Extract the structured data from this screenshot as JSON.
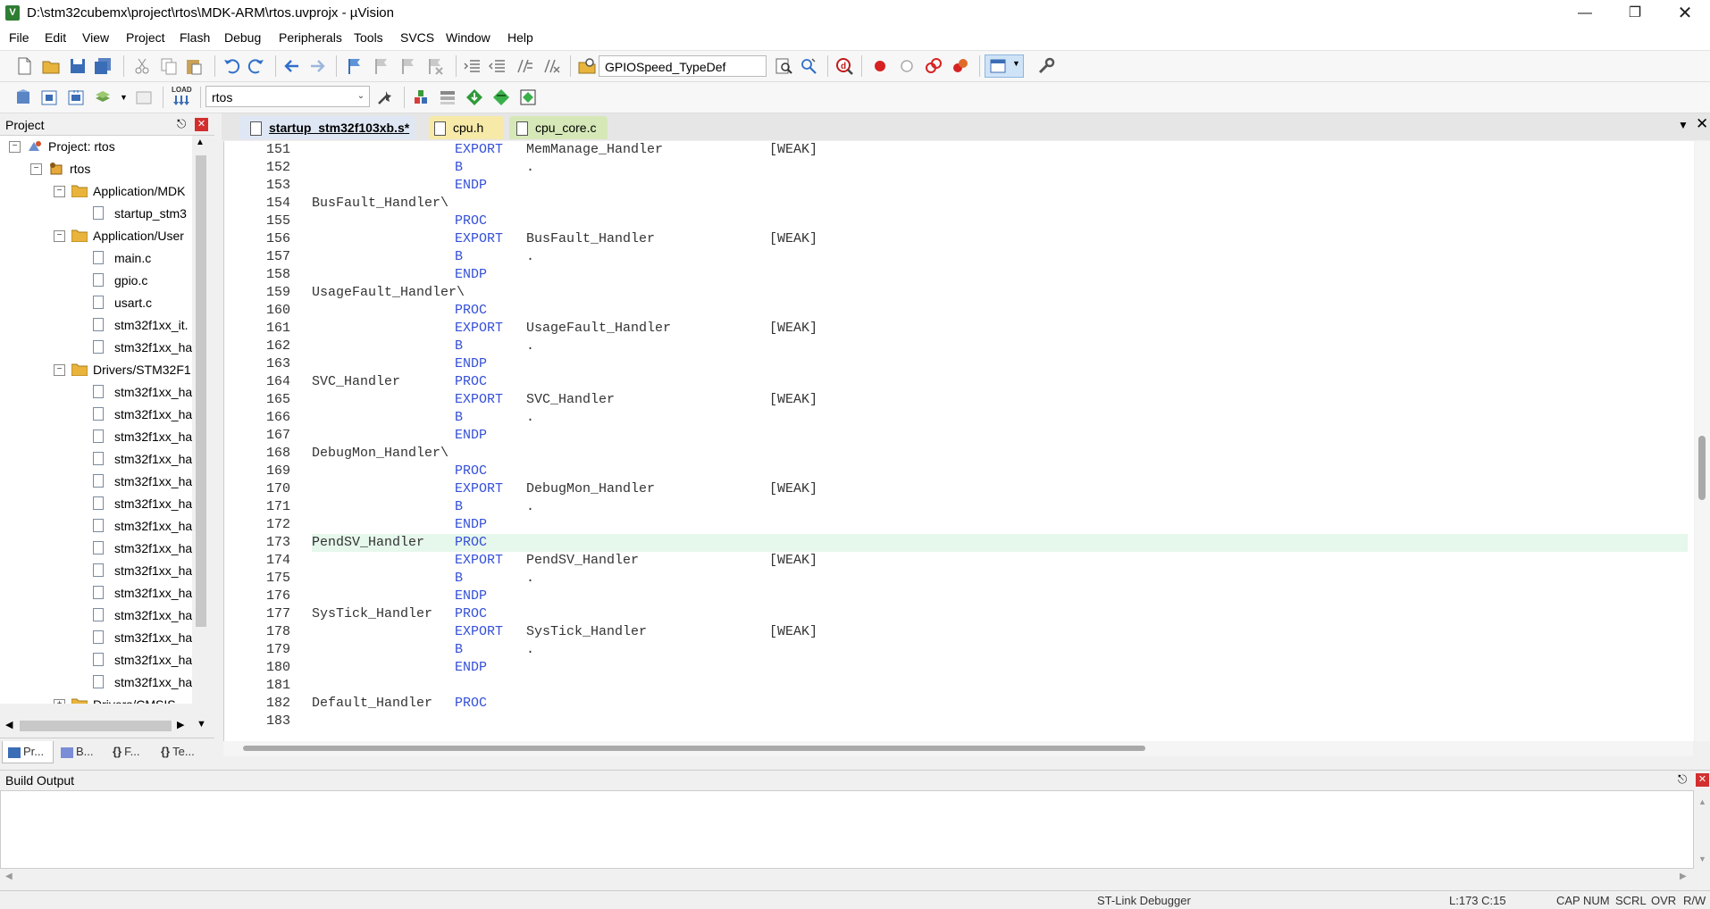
{
  "window": {
    "title": "D:\\stm32cubemx\\project\\rtos\\MDK-ARM\\rtos.uvprojx - µVision",
    "app_icon": "V"
  },
  "menu": [
    "File",
    "Edit",
    "View",
    "Project",
    "Flash",
    "Debug",
    "Peripherals",
    "Tools",
    "SVCS",
    "Window",
    "Help"
  ],
  "toolbar": {
    "find_combo_value": "GPIOSpeed_TypeDef",
    "target_combo_value": "rtos",
    "load_label": "LOAD"
  },
  "project_panel": {
    "title": "Project",
    "tree": [
      {
        "label": "Project: rtos",
        "level": 0,
        "kind": "project",
        "expanded": true
      },
      {
        "label": "rtos",
        "level": 1,
        "kind": "target",
        "expanded": true
      },
      {
        "label": "Application/MDK",
        "level": 2,
        "kind": "folder",
        "expanded": true
      },
      {
        "label": "startup_stm3",
        "level": 3,
        "kind": "file"
      },
      {
        "label": "Application/User",
        "level": 2,
        "kind": "folder",
        "expanded": true
      },
      {
        "label": "main.c",
        "level": 3,
        "kind": "file"
      },
      {
        "label": "gpio.c",
        "level": 3,
        "kind": "file"
      },
      {
        "label": "usart.c",
        "level": 3,
        "kind": "file"
      },
      {
        "label": "stm32f1xx_it.",
        "level": 3,
        "kind": "file"
      },
      {
        "label": "stm32f1xx_ha",
        "level": 3,
        "kind": "file"
      },
      {
        "label": "Drivers/STM32F1",
        "level": 2,
        "kind": "folder",
        "expanded": true
      },
      {
        "label": "stm32f1xx_ha",
        "level": 3,
        "kind": "file"
      },
      {
        "label": "stm32f1xx_ha",
        "level": 3,
        "kind": "file"
      },
      {
        "label": "stm32f1xx_ha",
        "level": 3,
        "kind": "file"
      },
      {
        "label": "stm32f1xx_ha",
        "level": 3,
        "kind": "file"
      },
      {
        "label": "stm32f1xx_ha",
        "level": 3,
        "kind": "file"
      },
      {
        "label": "stm32f1xx_ha",
        "level": 3,
        "kind": "file"
      },
      {
        "label": "stm32f1xx_ha",
        "level": 3,
        "kind": "file"
      },
      {
        "label": "stm32f1xx_ha",
        "level": 3,
        "kind": "file"
      },
      {
        "label": "stm32f1xx_ha",
        "level": 3,
        "kind": "file"
      },
      {
        "label": "stm32f1xx_ha",
        "level": 3,
        "kind": "file"
      },
      {
        "label": "stm32f1xx_ha",
        "level": 3,
        "kind": "file"
      },
      {
        "label": "stm32f1xx_ha",
        "level": 3,
        "kind": "file"
      },
      {
        "label": "stm32f1xx_ha",
        "level": 3,
        "kind": "file"
      },
      {
        "label": "stm32f1xx_ha",
        "level": 3,
        "kind": "file"
      },
      {
        "label": "Drivers/CMSIS",
        "level": 2,
        "kind": "folder",
        "expanded": false
      }
    ],
    "tabs": [
      "Pr...",
      "B...",
      "F...",
      "Te..."
    ],
    "tab_glyphs": [
      "",
      "",
      "{}",
      "{}"
    ]
  },
  "editor": {
    "tabs": [
      {
        "label": "startup_stm32f103xb.s*",
        "active": true,
        "color": "#dfe7f5"
      },
      {
        "label": "cpu.h",
        "active": false,
        "color": "#f7e9a8"
      },
      {
        "label": "cpu_core.c",
        "active": false,
        "color": "#d6e8b8"
      }
    ],
    "highlighted_line": 173,
    "lines": [
      {
        "n": "151",
        "label": "",
        "kw": "EXPORT",
        "arg": "MemManage_Handler",
        "weak": "[WEAK]"
      },
      {
        "n": "152",
        "label": "",
        "kw": "B",
        "arg": ".",
        "weak": ""
      },
      {
        "n": "153",
        "label": "",
        "kw": "ENDP",
        "arg": "",
        "weak": ""
      },
      {
        "n": "154",
        "label": "BusFault_Handler\\",
        "kw": "",
        "arg": "",
        "weak": ""
      },
      {
        "n": "155",
        "label": "",
        "kw": "PROC",
        "arg": "",
        "weak": ""
      },
      {
        "n": "156",
        "label": "",
        "kw": "EXPORT",
        "arg": "BusFault_Handler",
        "weak": "[WEAK]"
      },
      {
        "n": "157",
        "label": "",
        "kw": "B",
        "arg": ".",
        "weak": ""
      },
      {
        "n": "158",
        "label": "",
        "kw": "ENDP",
        "arg": "",
        "weak": ""
      },
      {
        "n": "159",
        "label": "UsageFault_Handler\\",
        "kw": "",
        "arg": "",
        "weak": ""
      },
      {
        "n": "160",
        "label": "",
        "kw": "PROC",
        "arg": "",
        "weak": ""
      },
      {
        "n": "161",
        "label": "",
        "kw": "EXPORT",
        "arg": "UsageFault_Handler",
        "weak": "[WEAK]"
      },
      {
        "n": "162",
        "label": "",
        "kw": "B",
        "arg": ".",
        "weak": ""
      },
      {
        "n": "163",
        "label": "",
        "kw": "ENDP",
        "arg": "",
        "weak": ""
      },
      {
        "n": "164",
        "label": "SVC_Handler",
        "kw": "PROC",
        "arg": "",
        "weak": ""
      },
      {
        "n": "165",
        "label": "",
        "kw": "EXPORT",
        "arg": "SVC_Handler",
        "weak": "[WEAK]"
      },
      {
        "n": "166",
        "label": "",
        "kw": "B",
        "arg": ".",
        "weak": ""
      },
      {
        "n": "167",
        "label": "",
        "kw": "ENDP",
        "arg": "",
        "weak": ""
      },
      {
        "n": "168",
        "label": "DebugMon_Handler\\",
        "kw": "",
        "arg": "",
        "weak": ""
      },
      {
        "n": "169",
        "label": "",
        "kw": "PROC",
        "arg": "",
        "weak": ""
      },
      {
        "n": "170",
        "label": "",
        "kw": "EXPORT",
        "arg": "DebugMon_Handler",
        "weak": "[WEAK]"
      },
      {
        "n": "171",
        "label": "",
        "kw": "B",
        "arg": ".",
        "weak": ""
      },
      {
        "n": "172",
        "label": "",
        "kw": "ENDP",
        "arg": "",
        "weak": ""
      },
      {
        "n": "173",
        "label": "PendSV_Handler",
        "kw": "PROC",
        "arg": "",
        "weak": ""
      },
      {
        "n": "174",
        "label": "",
        "kw": "EXPORT",
        "arg": "PendSV_Handler",
        "weak": "[WEAK]"
      },
      {
        "n": "175",
        "label": "",
        "kw": "B",
        "arg": ".",
        "weak": ""
      },
      {
        "n": "176",
        "label": "",
        "kw": "ENDP",
        "arg": "",
        "weak": ""
      },
      {
        "n": "177",
        "label": "SysTick_Handler",
        "kw": "PROC",
        "arg": "",
        "weak": ""
      },
      {
        "n": "178",
        "label": "",
        "kw": "EXPORT",
        "arg": "SysTick_Handler",
        "weak": "[WEAK]"
      },
      {
        "n": "179",
        "label": "",
        "kw": "B",
        "arg": ".",
        "weak": ""
      },
      {
        "n": "180",
        "label": "",
        "kw": "ENDP",
        "arg": "",
        "weak": ""
      },
      {
        "n": "181",
        "label": "",
        "kw": "",
        "arg": "",
        "weak": ""
      },
      {
        "n": "182",
        "label": "Default_Handler",
        "kw": "PROC",
        "arg": "",
        "weak": ""
      },
      {
        "n": "183",
        "label": "",
        "kw": "",
        "arg": "",
        "weak": ""
      }
    ]
  },
  "build_output": {
    "title": "Build Output"
  },
  "status_bar": {
    "debugger": "ST-Link Debugger",
    "position": "L:173 C:15",
    "indicators": [
      "CAP",
      "NUM",
      "SCRL",
      "OVR",
      "R/W"
    ]
  }
}
